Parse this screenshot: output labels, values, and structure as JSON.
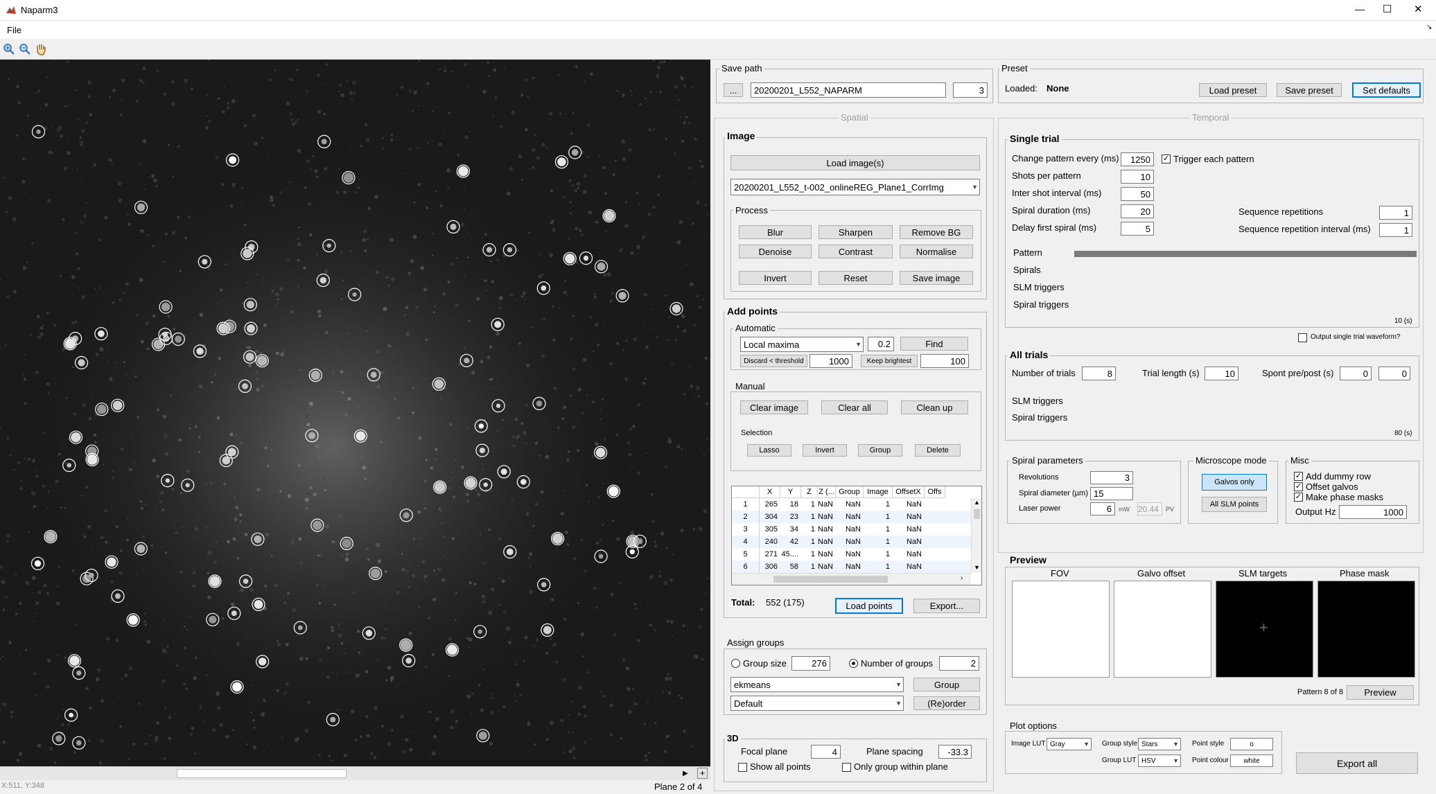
{
  "window": {
    "title": "Naparm3",
    "minimize": "—",
    "maximize": "☐",
    "close": "✕"
  },
  "menu": {
    "file": "File"
  },
  "status": {
    "coords": "X:511, Y:348",
    "plane": "Plane 2 of 4",
    "scroll_left": "◀",
    "scroll_right": "▶",
    "scroll_plus": "+"
  },
  "save_path": {
    "label": "Save path",
    "browse": "...",
    "value": "20200201_L552_NAPARM",
    "number": "3"
  },
  "preset": {
    "label": "Preset",
    "loaded_label": "Loaded:",
    "loaded_value": "None",
    "load": "Load preset",
    "save": "Save preset",
    "defaults": "Set defaults"
  },
  "spatial": {
    "label": "Spatial"
  },
  "temporal": {
    "label": "Temporal"
  },
  "image": {
    "label": "Image",
    "load": "Load image(s)",
    "selected": "20200201_L552_t-002_onlineREG_Plane1_CorrImg",
    "process_label": "Process",
    "buttons": [
      "Blur",
      "Sharpen",
      "Remove BG",
      "Denoise",
      "Contrast",
      "Normalise",
      "Invert",
      "Reset",
      "Save image"
    ]
  },
  "add_points": {
    "label": "Add points",
    "automatic_label": "Automatic",
    "method": "Local maxima",
    "threshold": "0.2",
    "find": "Find",
    "discard_btn": "Discard < threshold",
    "discard_value": "1000",
    "keep_btn": "Keep brightest",
    "keep_value": "100",
    "manual_label": "Manual",
    "clear_image": "Clear image",
    "clear_all": "Clear all",
    "clean_up": "Clean up",
    "selection_label": "Selection",
    "lasso": "Lasso",
    "invert": "Invert",
    "group": "Group",
    "delete": "Delete"
  },
  "table": {
    "headers": [
      "X",
      "Y",
      "Z",
      "Z (...",
      "Group",
      "Image",
      "OffsetX",
      "Offs"
    ],
    "rows": [
      {
        "n": "1",
        "x": "265",
        "y": "18",
        "z": "1",
        "zz": "NaN",
        "group": "NaN",
        "image": "1",
        "ox": "NaN"
      },
      {
        "n": "2",
        "x": "304",
        "y": "23",
        "z": "1",
        "zz": "NaN",
        "group": "NaN",
        "image": "1",
        "ox": "NaN"
      },
      {
        "n": "3",
        "x": "305",
        "y": "34",
        "z": "1",
        "zz": "NaN",
        "group": "NaN",
        "image": "1",
        "ox": "NaN"
      },
      {
        "n": "4",
        "x": "240",
        "y": "42",
        "z": "1",
        "zz": "NaN",
        "group": "NaN",
        "image": "1",
        "ox": "NaN"
      },
      {
        "n": "5",
        "x": "271",
        "y": "45....",
        "z": "1",
        "zz": "NaN",
        "group": "NaN",
        "image": "1",
        "ox": "NaN"
      },
      {
        "n": "6",
        "x": "306",
        "y": "58",
        "z": "1",
        "zz": "NaN",
        "group": "NaN",
        "image": "1",
        "ox": "NaN"
      }
    ]
  },
  "total": {
    "label": "Total:",
    "value": "552 (175)",
    "load_points": "Load points",
    "export": "Export..."
  },
  "assign_groups": {
    "label": "Assign groups",
    "group_size_label": "Group size",
    "group_size": "276",
    "num_groups_label": "Number of groups",
    "num_groups": "2",
    "method": "ekmeans",
    "group_btn": "Group",
    "order_method": "Default",
    "reorder_btn": "(Re)order"
  },
  "three_d": {
    "label": "3D",
    "focal_label": "Focal plane",
    "focal": "4",
    "spacing_label": "Plane spacing",
    "spacing": "-33.3",
    "show_all": "Show all points",
    "only_group": "Only group within plane"
  },
  "single_trial": {
    "label": "Single trial",
    "change_label": "Change pattern every (ms)",
    "change": "1250",
    "trigger_each": "Trigger each pattern",
    "shots_label": "Shots per pattern",
    "shots": "10",
    "isi_label": "Inter shot interval (ms)",
    "isi": "50",
    "spiral_dur_label": "Spiral duration (ms)",
    "spiral_dur": "20",
    "delay_label": "Delay first spiral (ms)",
    "delay": "5",
    "seq_rep_label": "Sequence repetitions",
    "seq_rep": "1",
    "seq_int_label": "Sequence repetition interval (ms)",
    "seq_int": "1",
    "tracks": [
      "Pattern",
      "Spirals",
      "SLM triggers",
      "Spiral triggers"
    ],
    "duration": "10 (s)",
    "output_waveform": "Output single trial waveform?"
  },
  "all_trials": {
    "label": "All trials",
    "num_label": "Number of trials",
    "num": "8",
    "length_label": "Trial length (s)",
    "length": "10",
    "spont_label": "Spont pre/post (s)",
    "spont_pre": "0",
    "spont_post": "0",
    "tracks": [
      "SLM triggers",
      "Spiral triggers"
    ],
    "duration": "80 (s)"
  },
  "spiral": {
    "label": "Spiral parameters",
    "rev_label": "Revolutions",
    "rev": "3",
    "diam_label": "Spiral diameter (µm)",
    "diam": "15",
    "power_label": "Laser power",
    "power": "6",
    "power_unit": "mW",
    "pv": "20.44",
    "pv_unit": "PV"
  },
  "microscope": {
    "label": "Microscope mode",
    "galvos": "Galvos only",
    "slm": "All SLM points"
  },
  "misc": {
    "label": "Misc",
    "dummy": "Add dummy row",
    "offset": "Offset galvos",
    "phase": "Make phase masks",
    "hz_label": "Output Hz",
    "hz": "1000"
  },
  "preview": {
    "label": "Preview",
    "panels": [
      "FOV",
      "Galvo offset",
      "SLM targets",
      "Phase mask"
    ],
    "pattern": "Pattern 8 of 8",
    "btn": "Preview"
  },
  "plot_options": {
    "label": "Plot options",
    "lut_label": "Image LUT",
    "lut": "Gray",
    "group_style_label": "Group style",
    "group_style": "Stars",
    "group_lut_label": "Group LUT",
    "group_lut": "HSV",
    "point_style_label": "Point style",
    "point_style": "o",
    "point_colour_label": "Point colour",
    "point_colour": "white"
  },
  "export_all": "Export all",
  "icons": [
    "matlab-icon",
    "zoom-in-icon",
    "zoom-out-icon",
    "pan-icon"
  ]
}
